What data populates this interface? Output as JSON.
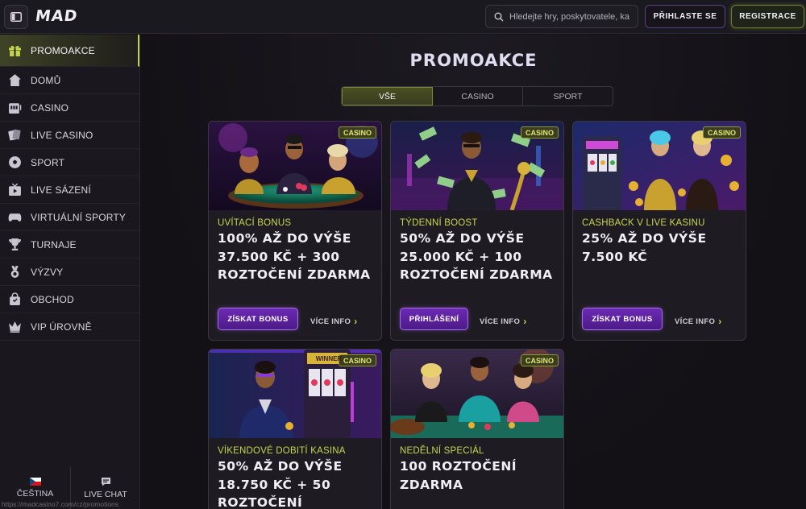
{
  "header": {
    "logo": "MAD",
    "search_placeholder": "Hledejte hry, poskytovatele, ka...",
    "login_label": "PŘIHLASTE SE",
    "register_label": "REGISTRACE"
  },
  "sidebar": {
    "items": [
      {
        "label": "PROMOAKCE",
        "icon": "gift-icon"
      },
      {
        "label": "DOMŮ",
        "icon": "home-icon"
      },
      {
        "label": "CASINO",
        "icon": "slot-machine-icon"
      },
      {
        "label": "LIVE CASINO",
        "icon": "cards-icon"
      },
      {
        "label": "SPORT",
        "icon": "soccer-ball-icon"
      },
      {
        "label": "LIVE SÁZENÍ",
        "icon": "tv-icon"
      },
      {
        "label": "VIRTUÁLNÍ SPORTY",
        "icon": "gamepad-icon"
      },
      {
        "label": "TURNAJE",
        "icon": "trophy-icon"
      },
      {
        "label": "VÝZVY",
        "icon": "medal-icon"
      },
      {
        "label": "OBCHOD",
        "icon": "shopping-bag-icon"
      },
      {
        "label": "VIP ÚROVNĚ",
        "icon": "crown-icon"
      }
    ],
    "footer": {
      "language_label": "ČEŠTINA",
      "chat_label": "LIVE CHAT"
    },
    "status_url": "https://madcasino7.com/cz/promotions"
  },
  "main": {
    "title": "PROMOAKCE",
    "tabs": [
      "VŠE",
      "CASINO",
      "SPORT"
    ],
    "active_tab": "VŠE",
    "cards": [
      {
        "badge": "CASINO",
        "category": "UVÍTACÍ BONUS",
        "headline": "100% AŽ DO VÝŠE 37.500 KČ + 300 ROZTOČENÍ ZDARMA",
        "cta": "ZÍSKAT BONUS",
        "more": "VÍCE INFO"
      },
      {
        "badge": "CASINO",
        "category": "TÝDENNÍ BOOST",
        "headline": "50% AŽ DO VÝŠE 25.000 KČ + 100 ROZTOČENÍ ZDARMA",
        "cta": "PŘIHLÁŠENÍ",
        "more": "VÍCE INFO"
      },
      {
        "badge": "CASINO",
        "category": "CASHBACK V LIVE KASINU",
        "headline": "25% AŽ DO VÝŠE 7.500 KČ",
        "cta": "ZÍSKAT BONUS",
        "more": "VÍCE INFO"
      },
      {
        "badge": "CASINO",
        "category": "VÍKENDOVÉ DOBITÍ KASINA",
        "headline": "50% AŽ DO VÝŠE 18.750 KČ + 50 ROZTOČENÍ",
        "image_text": "WINNER"
      },
      {
        "badge": "CASINO",
        "category": "NEDĚLNÍ SPECIÁL",
        "headline": "100 ROZTOČENÍ ZDARMA"
      }
    ]
  }
}
